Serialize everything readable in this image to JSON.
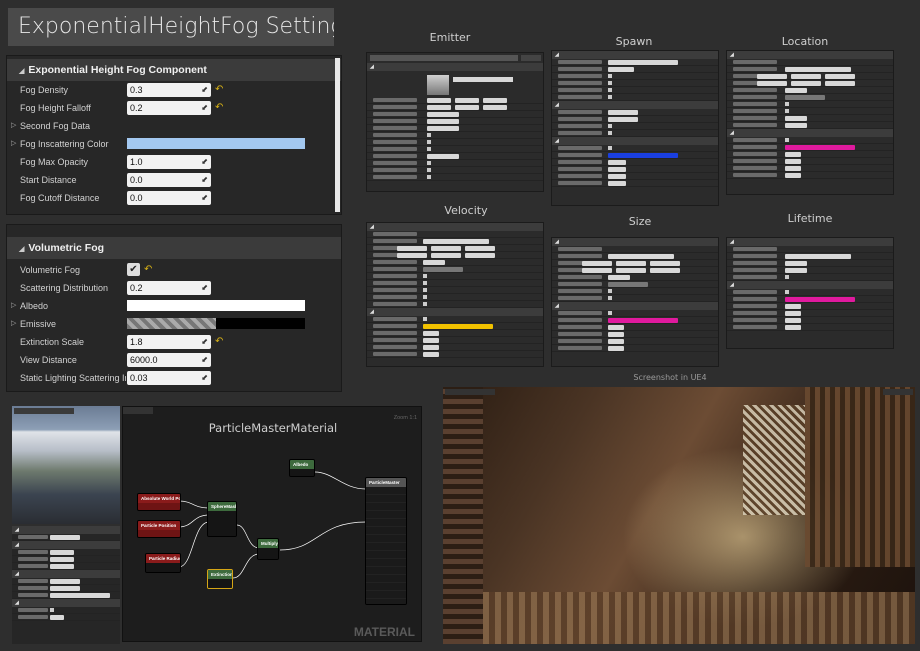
{
  "title": "ExponentialHeightFog Settings",
  "fog_component": {
    "header": "Exponential Height Fog Component",
    "rows": [
      {
        "label": "Fog Density",
        "value": "0.3"
      },
      {
        "label": "Fog Height Falloff",
        "value": "0.2"
      },
      {
        "label": "Second Fog Data"
      },
      {
        "label": "Fog Inscattering Color"
      },
      {
        "label": "Fog Max Opacity",
        "value": "1.0"
      },
      {
        "label": "Start Distance",
        "value": "0.0"
      },
      {
        "label": "Fog Cutoff Distance",
        "value": "0.0"
      }
    ]
  },
  "volumetric": {
    "header": "Volumetric Fog",
    "rows": [
      {
        "label": "Volumetric Fog"
      },
      {
        "label": "Scattering Distribution",
        "value": "0.2"
      },
      {
        "label": "Albedo"
      },
      {
        "label": "Emissive"
      },
      {
        "label": "Extinction Scale",
        "value": "1.8"
      },
      {
        "label": "View Distance",
        "value": "6000.0"
      },
      {
        "label": "Static Lighting Scattering Int",
        "value": "0.03"
      }
    ]
  },
  "panel_titles": {
    "emitter": "Emitter",
    "spawn": "Spawn",
    "location": "Location",
    "velocity": "Velocity",
    "size": "Size",
    "lifetime": "Lifetime",
    "screenshot": "Screenshot in UE4"
  },
  "material": {
    "title": "ParticleMasterMaterial",
    "watermark": "MATERIAL",
    "zoom": "Zoom 1:1",
    "nodes": {
      "absolute_world": "Absolute World Position",
      "particle_position": "Particle Position",
      "particle_radius": "Particle Radius",
      "sphere_mask": "SphereMask",
      "multiply": "Multiply",
      "albedo": "Albedo",
      "extinction": "Extinction",
      "output": "ParticleMaster"
    }
  },
  "colors": {
    "inscattering": "#a3c8f0",
    "albedo": "#ffffff",
    "accent_yellow": "#d6b016"
  }
}
